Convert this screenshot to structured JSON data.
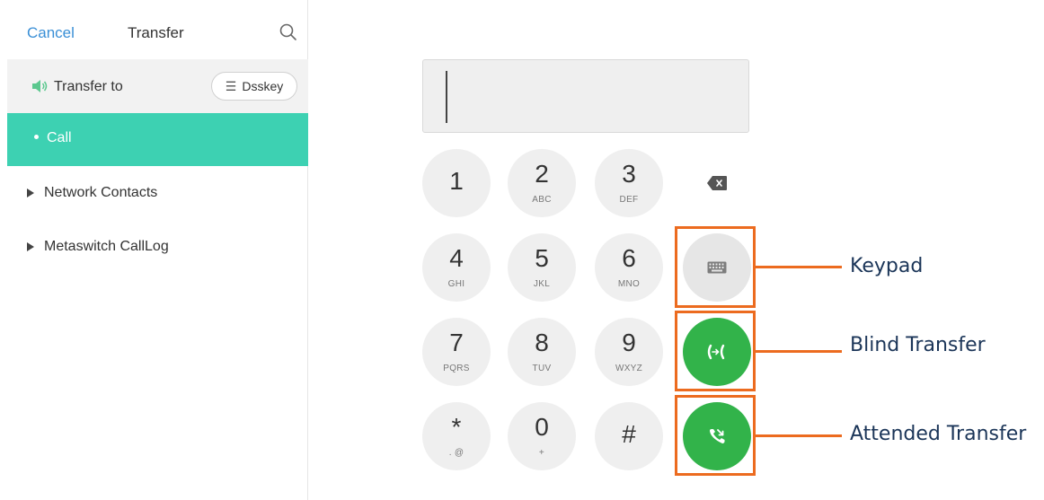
{
  "header": {
    "cancel_label": "Cancel",
    "title": "Transfer",
    "search_icon": "search-icon"
  },
  "transfer_to": {
    "label": "Transfer to",
    "icon": "speaker-icon",
    "dsskey_label": "Dsskey",
    "dsskey_icon": "list-icon"
  },
  "sidebar": {
    "items": [
      {
        "label": "Call",
        "selected": true
      },
      {
        "label": "Network Contacts"
      },
      {
        "label": "Metaswitch CallLog"
      }
    ]
  },
  "dialpad": {
    "input_value": "",
    "keys": [
      {
        "digit": "1",
        "letters": ""
      },
      {
        "digit": "2",
        "letters": "ABC"
      },
      {
        "digit": "3",
        "letters": "DEF"
      },
      {
        "digit": "4",
        "letters": "GHI"
      },
      {
        "digit": "5",
        "letters": "JKL"
      },
      {
        "digit": "6",
        "letters": "MNO"
      },
      {
        "digit": "7",
        "letters": "PQRS"
      },
      {
        "digit": "8",
        "letters": "TUV"
      },
      {
        "digit": "9",
        "letters": "WXYZ"
      },
      {
        "digit": "*",
        "letters": ". @"
      },
      {
        "digit": "0",
        "letters": "+"
      },
      {
        "digit": "#",
        "letters": ""
      }
    ]
  },
  "actions": {
    "backspace_icon": "backspace-icon",
    "keypad_icon": "keyboard-icon",
    "blind_transfer_icon": "blind-transfer-icon",
    "attended_transfer_icon": "attended-transfer-icon"
  },
  "callouts": {
    "keypad": "Keypad",
    "blind_transfer": "Blind Transfer",
    "attended_transfer": "Attended Transfer"
  },
  "colors": {
    "accent_teal": "#3dd1b2",
    "link_blue": "#3a8fd6",
    "call_green": "#32b34a",
    "highlight_orange": "#ec6b1f",
    "callout_text": "#1b3558"
  }
}
